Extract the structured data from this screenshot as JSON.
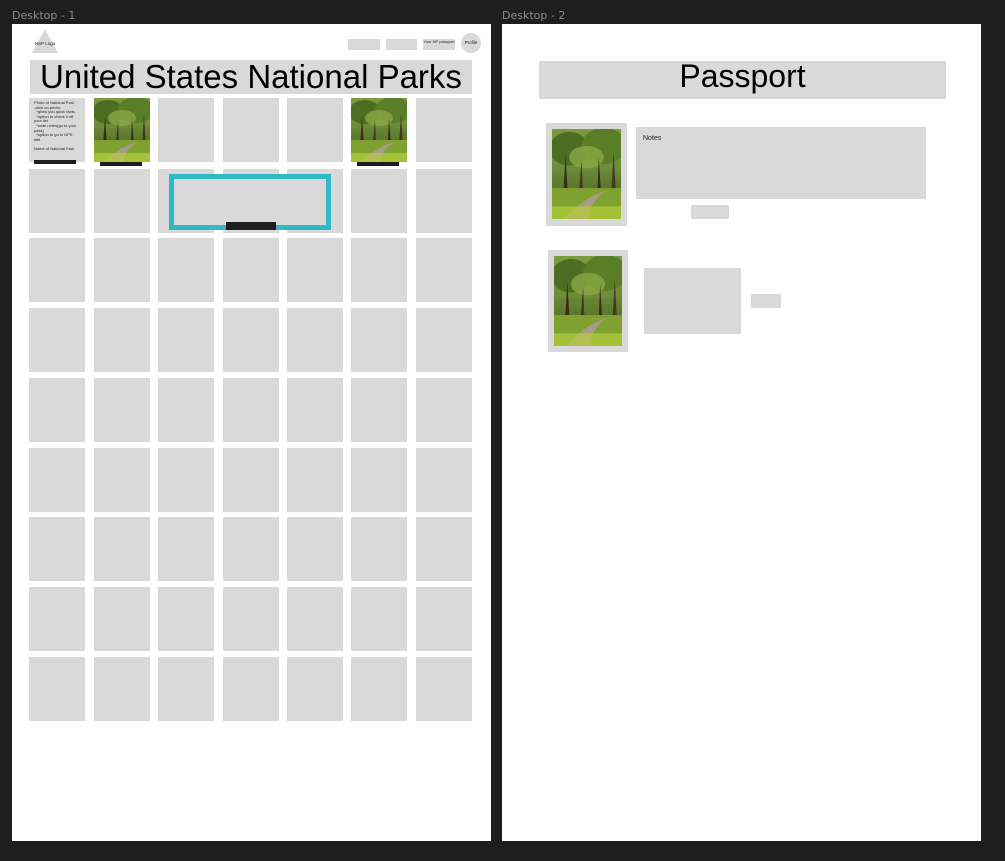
{
  "frames": {
    "desktop1_label": "Desktop - 1",
    "desktop2_label": "Desktop - 2"
  },
  "desktop1": {
    "logo_text": "NSP Logo",
    "nav": {
      "passport_label": "Your NP passport",
      "profile_label": "Profile"
    },
    "title": "United States National Parks",
    "info_lines": [
      "Photo of National Park",
      "-click on photo:",
      "  *gives you quick facts.",
      "  *option to check it off",
      "your list",
      "  *write notes(go to your",
      "pass)",
      "  *option to go to NPS",
      "site",
      "",
      "Name of National Park"
    ]
  },
  "desktop2": {
    "title": "Passport",
    "notes_label": "Notes"
  },
  "colors": {
    "canvas": "#1e1e1e",
    "frame": "#ffffff",
    "placeholder": "#d9d9d9",
    "highlight": "#2fb8c6",
    "dark_bar": "#1e1e1e"
  }
}
